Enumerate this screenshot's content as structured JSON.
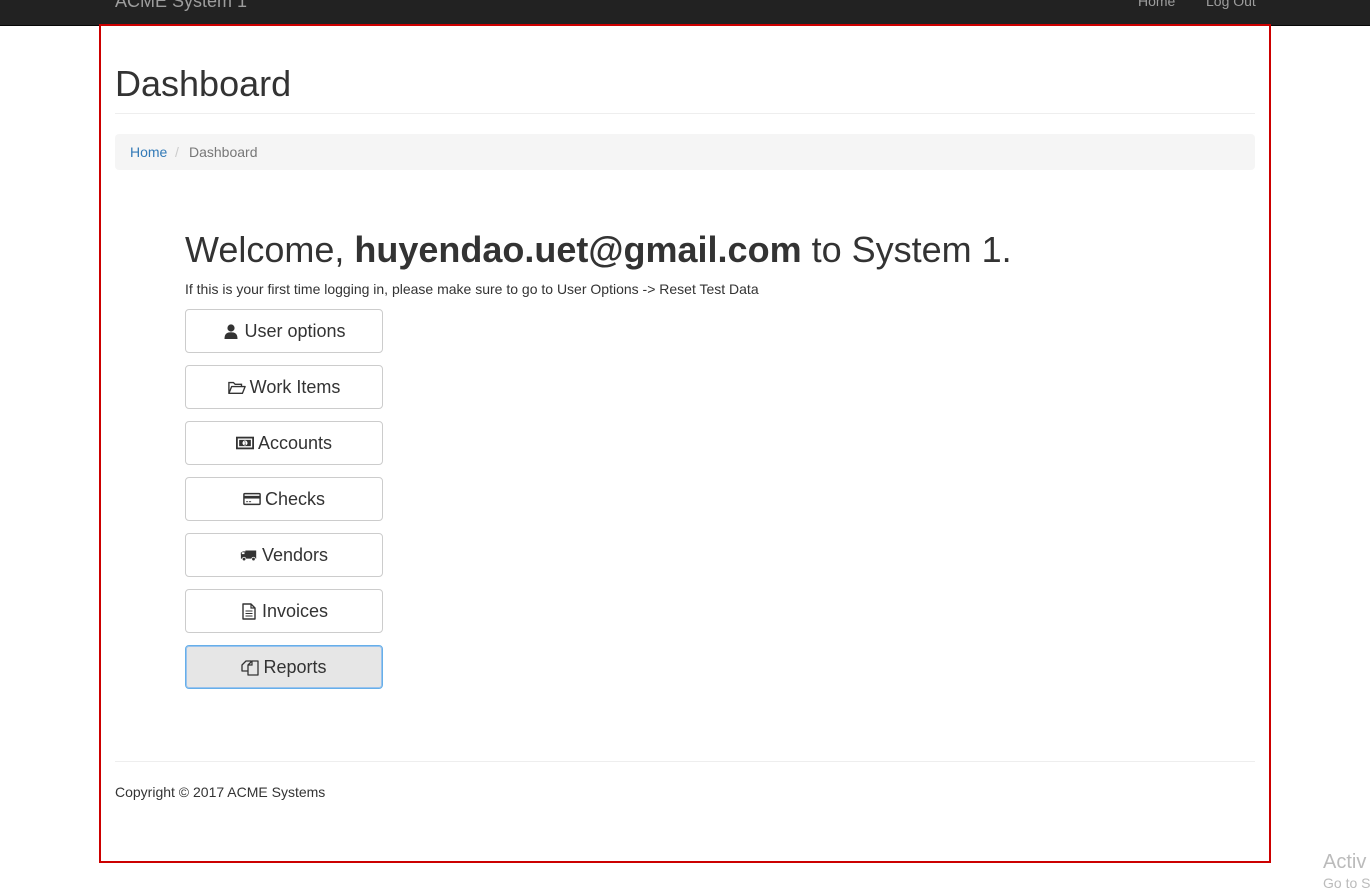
{
  "navbar": {
    "brand": "ACME System 1",
    "links": [
      "Home",
      "Log Out"
    ]
  },
  "page": {
    "title": "Dashboard"
  },
  "breadcrumb": {
    "home": "Home",
    "separator": "/",
    "current": "Dashboard"
  },
  "welcome": {
    "prefix": "Welcome,",
    "user": "huyendao.uet@gmail.com",
    "suffix": "to System 1.",
    "note": "If this is your first time logging in, please make sure to go to User Options -> Reset Test Data"
  },
  "buttons": [
    {
      "label": "User options",
      "icon": "user-icon"
    },
    {
      "label": "Work Items",
      "icon": "folder-open-icon"
    },
    {
      "label": "Accounts",
      "icon": "money-icon"
    },
    {
      "label": "Checks",
      "icon": "credit-card-icon"
    },
    {
      "label": "Vendors",
      "icon": "truck-icon"
    },
    {
      "label": "Invoices",
      "icon": "file-text-icon"
    },
    {
      "label": "Reports",
      "icon": "copy-icon",
      "state": "focused"
    }
  ],
  "footer": {
    "copyright": "Copyright © 2017 ACME Systems"
  },
  "watermark": {
    "line1": "Activ",
    "line2": "Go to S"
  },
  "colors": {
    "navbar": "#222222",
    "link": "#337ab7",
    "frame_border": "#cc0000"
  }
}
